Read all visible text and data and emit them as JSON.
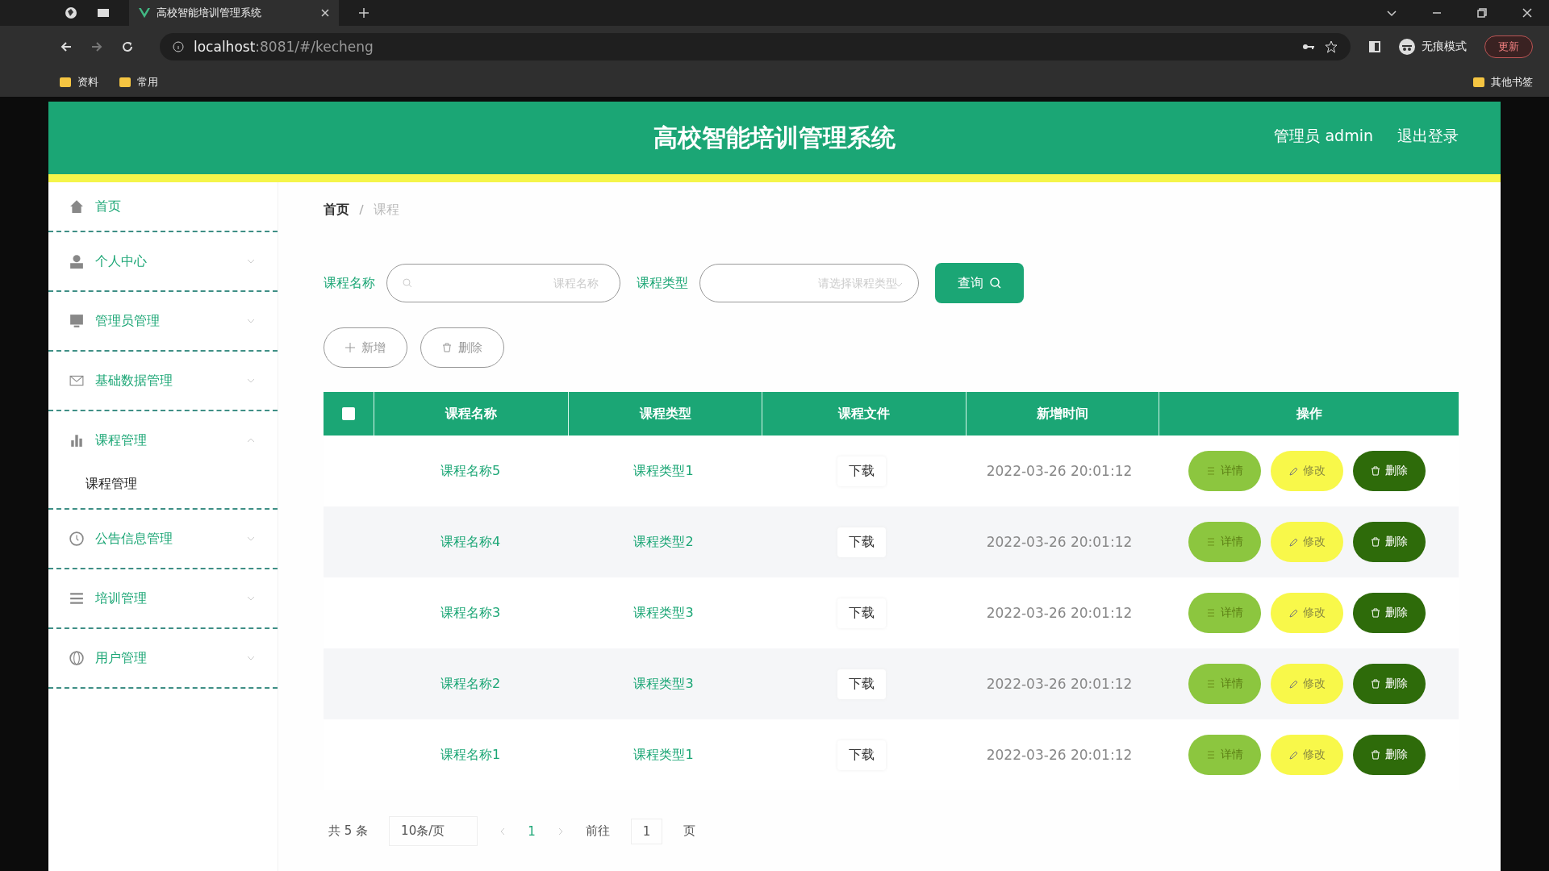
{
  "browser": {
    "tab_title": "高校智能培训管理系统",
    "url_host": "localhost",
    "url_rest": ":8081/#/kecheng",
    "incognito": "无痕模式",
    "update": "更新",
    "bookmarks": [
      "资料",
      "常用"
    ],
    "other_bookmarks": "其他书签"
  },
  "header": {
    "title": "高校智能培训管理系统",
    "user": "管理员 admin",
    "logout": "退出登录"
  },
  "sidebar": {
    "items": [
      {
        "label": "首页"
      },
      {
        "label": "个人中心",
        "expanded": false
      },
      {
        "label": "管理员管理",
        "expanded": false
      },
      {
        "label": "基础数据管理",
        "expanded": false
      },
      {
        "label": "课程管理",
        "expanded": true,
        "children": [
          {
            "label": "课程管理",
            "selected": true
          }
        ]
      },
      {
        "label": "公告信息管理",
        "expanded": false
      },
      {
        "label": "培训管理",
        "expanded": false
      },
      {
        "label": "用户管理",
        "expanded": false
      }
    ]
  },
  "breadcrumb": [
    "首页",
    "课程"
  ],
  "search": {
    "name_label": "课程名称",
    "name_placeholder": "课程名称",
    "type_label": "课程类型",
    "type_placeholder": "请选择课程类型",
    "button": "查询"
  },
  "actions": {
    "add": "新增",
    "delete": "删除"
  },
  "table": {
    "select_all_checked": false,
    "columns": [
      "课程名称",
      "课程类型",
      "课程文件",
      "新增时间",
      "操作"
    ],
    "rows": [
      {
        "name": "课程名称5",
        "type": "课程类型1",
        "file": "下载",
        "time": "2022-03-26 20:01:12",
        "buttons": [
          "详情",
          "修改",
          "删除"
        ]
      },
      {
        "name": "课程名称4",
        "type": "课程类型2",
        "file": "下载",
        "time": "2022-03-26 20:01:12",
        "buttons": [
          "详情",
          "修改",
          "删除"
        ]
      },
      {
        "name": "课程名称3",
        "type": "课程类型3",
        "file": "下载",
        "time": "2022-03-26 20:01:12",
        "buttons": [
          "详情",
          "修改",
          "删除"
        ]
      },
      {
        "name": "课程名称2",
        "type": "课程类型3",
        "file": "下载",
        "time": "2022-03-26 20:01:12",
        "buttons": [
          "详情",
          "修改",
          "删除"
        ]
      },
      {
        "name": "课程名称1",
        "type": "课程类型1",
        "file": "下载",
        "time": "2022-03-26 20:01:12",
        "buttons": [
          "详情",
          "修改",
          "删除"
        ]
      }
    ]
  },
  "pagination": {
    "total": "共 5 条",
    "page_size": "10条/页",
    "pages": [
      {
        "label": "1",
        "selected": true
      }
    ],
    "goto_label": "前往",
    "goto_value": "1",
    "goto_suffix": "页"
  }
}
